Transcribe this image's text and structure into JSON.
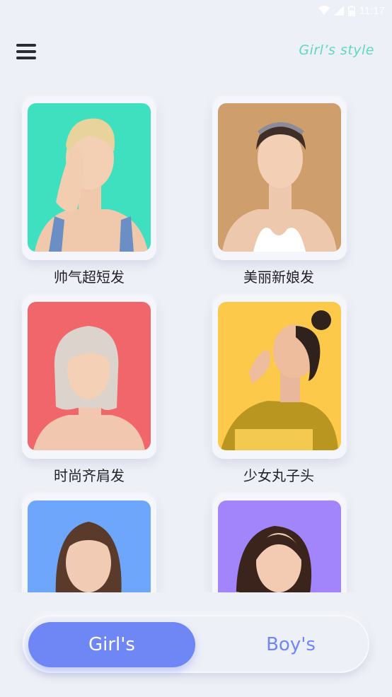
{
  "status_bar": {
    "time": "11:17",
    "icons": [
      "wifi-icon",
      "signal-icon",
      "battery-icon"
    ]
  },
  "header": {
    "menu_icon": "hamburger-menu-icon",
    "title": "Girl’s style",
    "title_color": "#5fd8c1"
  },
  "styles": [
    {
      "label": "帅气超短发",
      "bg": "#3fe0bf"
    },
    {
      "label": "美丽新娘发",
      "bg": "#cf9e6d"
    },
    {
      "label": "时尚齐肩发",
      "bg": "#f0666a"
    },
    {
      "label": "少女丸子头",
      "bg": "#fcc94b"
    },
    {
      "label": "",
      "bg": "#6ea6fb"
    },
    {
      "label": "",
      "bg": "#a284fb"
    }
  ],
  "tabs": {
    "girls": "Girl's",
    "boys": "Boy's",
    "active": "girls",
    "accent": "#6f87f5"
  }
}
